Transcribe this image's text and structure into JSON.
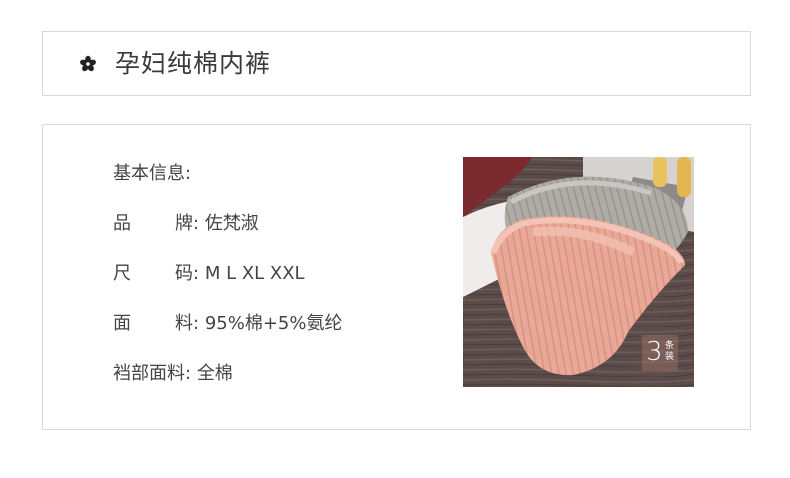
{
  "title": {
    "text": "孕妇纯棉内裤",
    "icon": "flower-icon"
  },
  "info": {
    "heading": "基本信息:",
    "rows": [
      {
        "label_a": "品",
        "label_b": "牌",
        "value": "佐梵淑"
      },
      {
        "label_a": "尺",
        "label_b": "码",
        "value": "M L XL XXL"
      },
      {
        "label_a": "面",
        "label_b": "料",
        "value": "95%棉+5%氨纶"
      }
    ],
    "crotch": {
      "label": "裆部面料",
      "value": "全棉"
    },
    "colon": ":"
  },
  "photo": {
    "badge_number": "3",
    "badge_text": "条装"
  },
  "colors": {
    "border": "#d9d9d9",
    "text": "#444444",
    "pink": "#e8a797",
    "grey": "#a9a7a0",
    "wood": "#5a4a48"
  }
}
